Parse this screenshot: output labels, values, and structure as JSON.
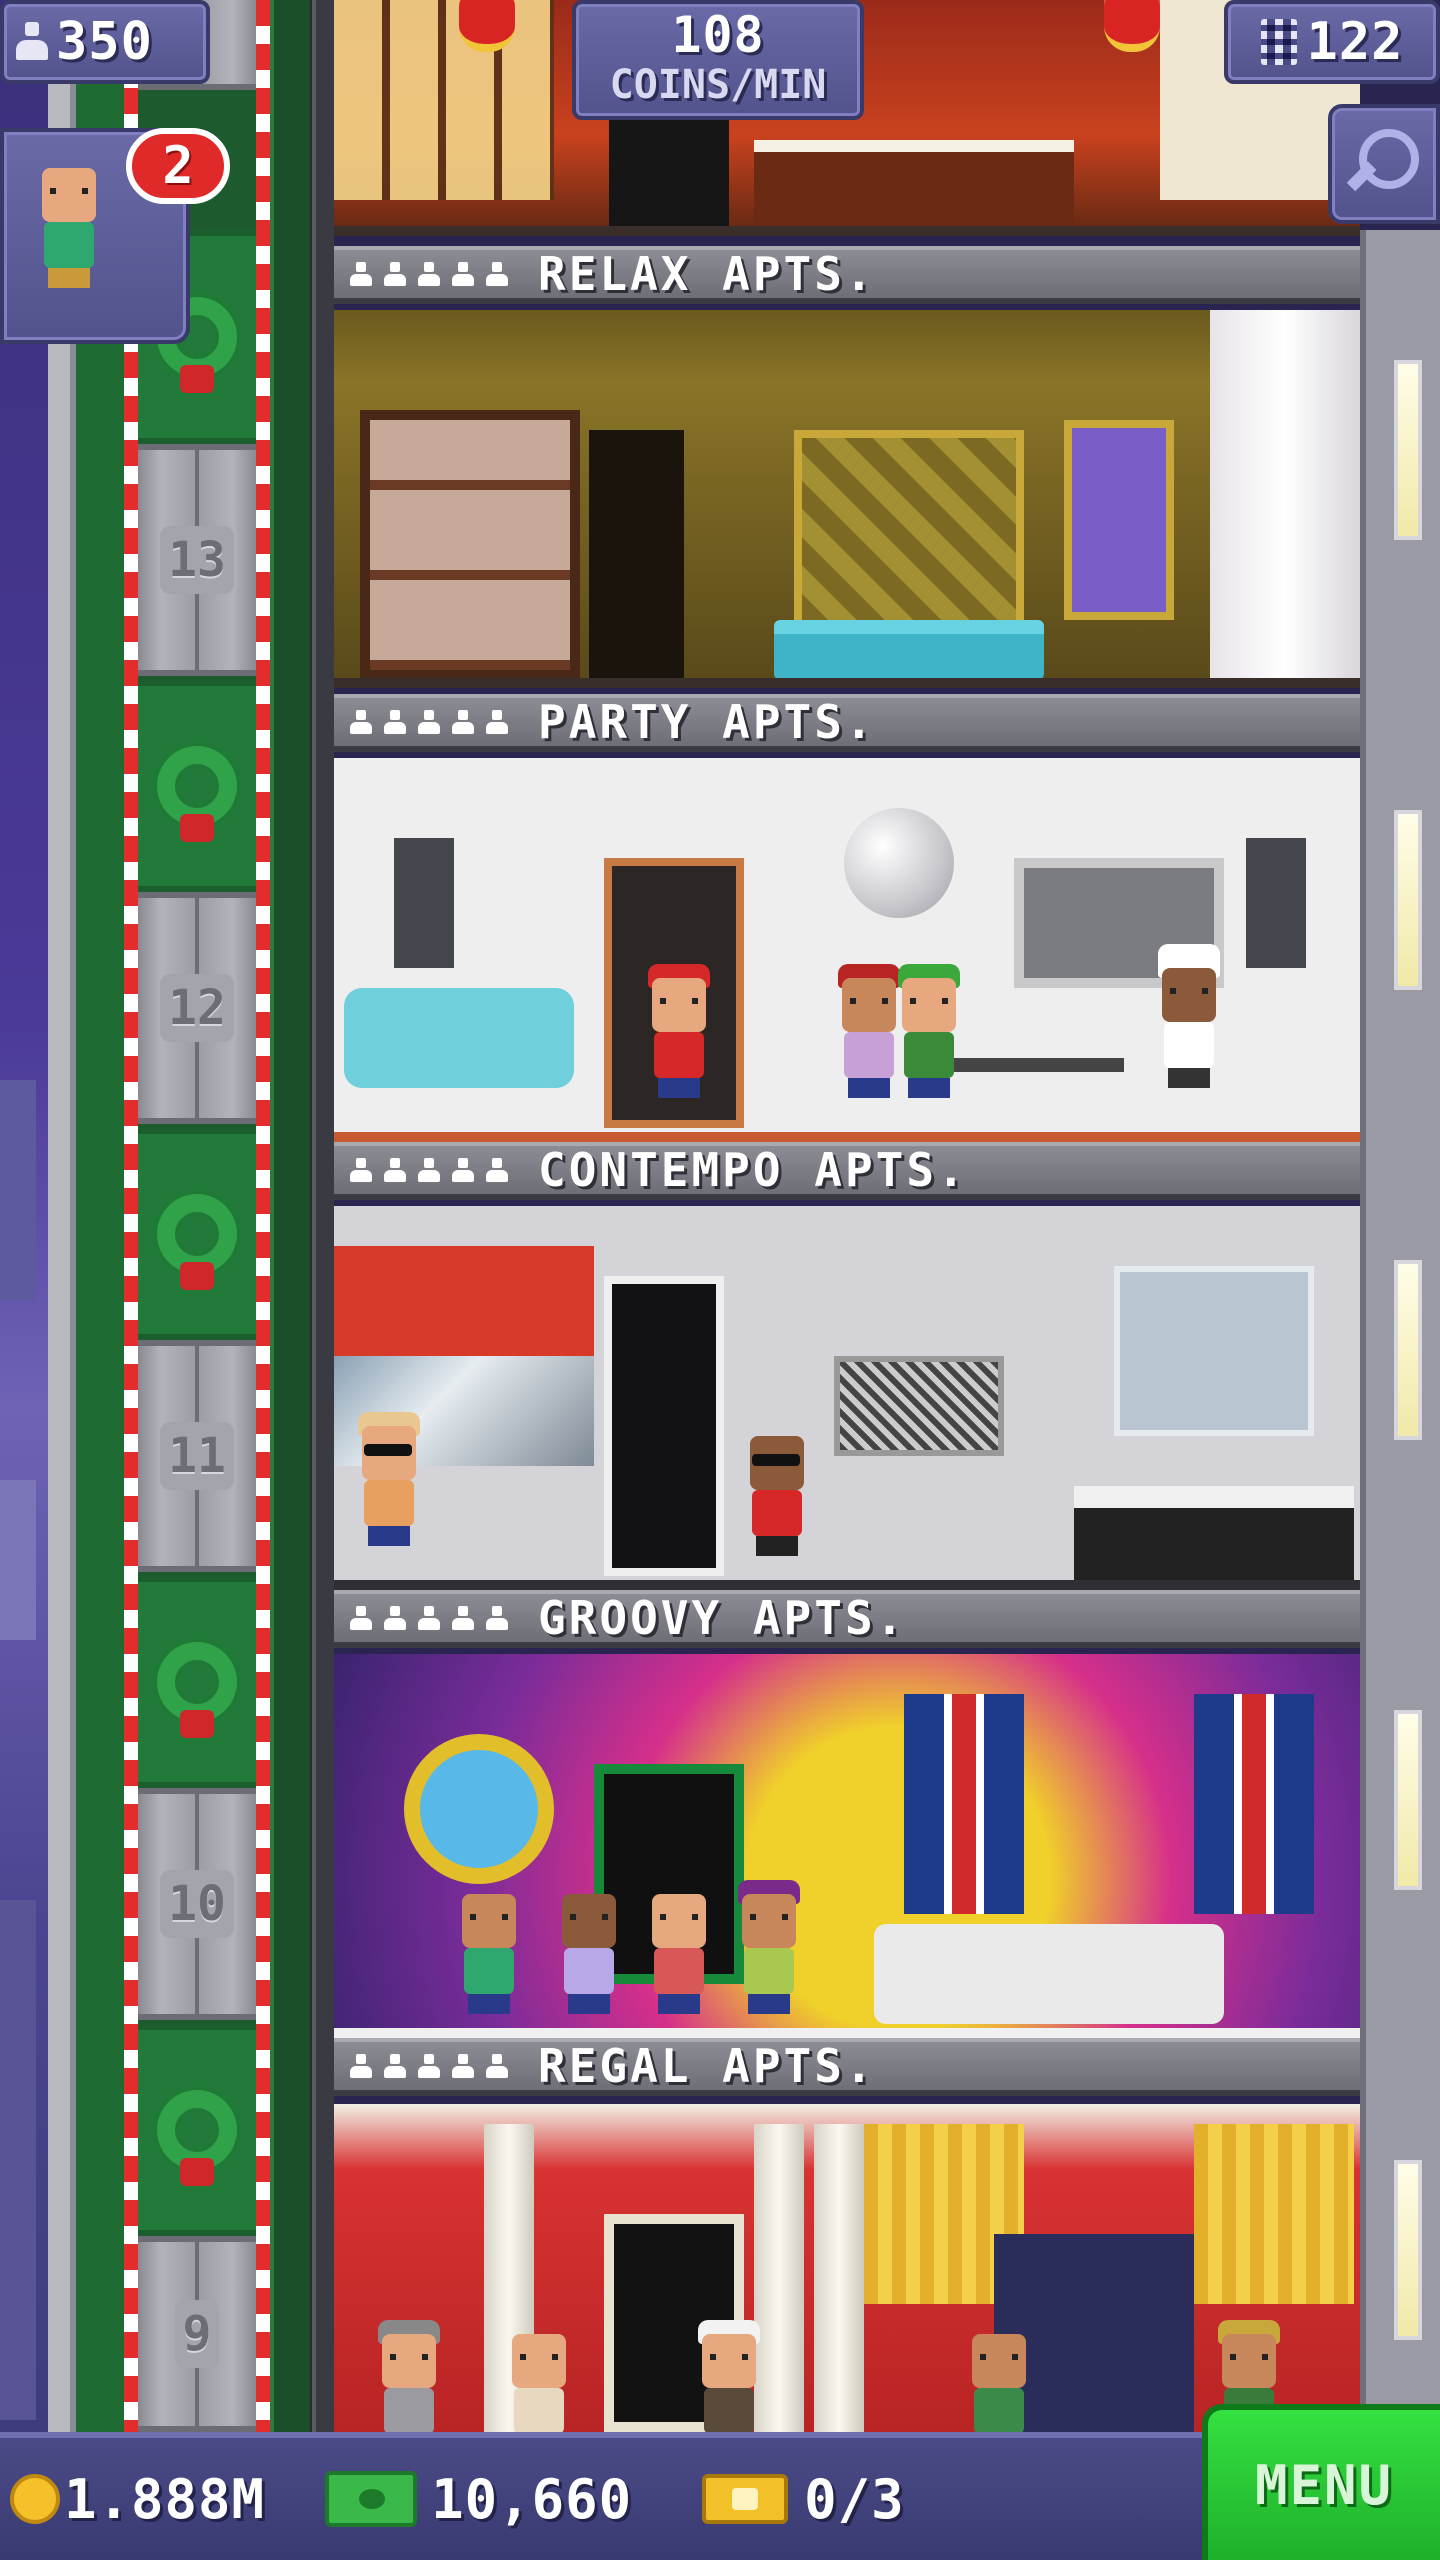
{
  "hud": {
    "population": "350",
    "coins_per_min_value": "108",
    "coins_per_min_label": "COINS/MIN",
    "floor_count": "122",
    "visitor_badge": "2"
  },
  "shaft_floors": [
    "13",
    "12",
    "11",
    "10",
    "9"
  ],
  "floors": [
    {
      "label": "RELAX APTS."
    },
    {
      "label": "PARTY APTS."
    },
    {
      "label": "CONTEMPO APTS."
    },
    {
      "label": "GROOVY APTS."
    },
    {
      "label": "REGAL APTS."
    }
  ],
  "bottom_bar": {
    "coins": "1.888M",
    "bux": "10,660",
    "tickets": "0/3",
    "menu_label": "MENU"
  },
  "colors": {
    "hud_panel": "#52528c",
    "menu_green": "#1fb02c",
    "badge_red": "#e02a2a",
    "shaft_green": "#1d5a2e"
  },
  "icons": [
    "population-icon",
    "floors-icon",
    "search-icon",
    "coin-icon",
    "bux-icon",
    "ticket-icon",
    "wreath-icon"
  ]
}
